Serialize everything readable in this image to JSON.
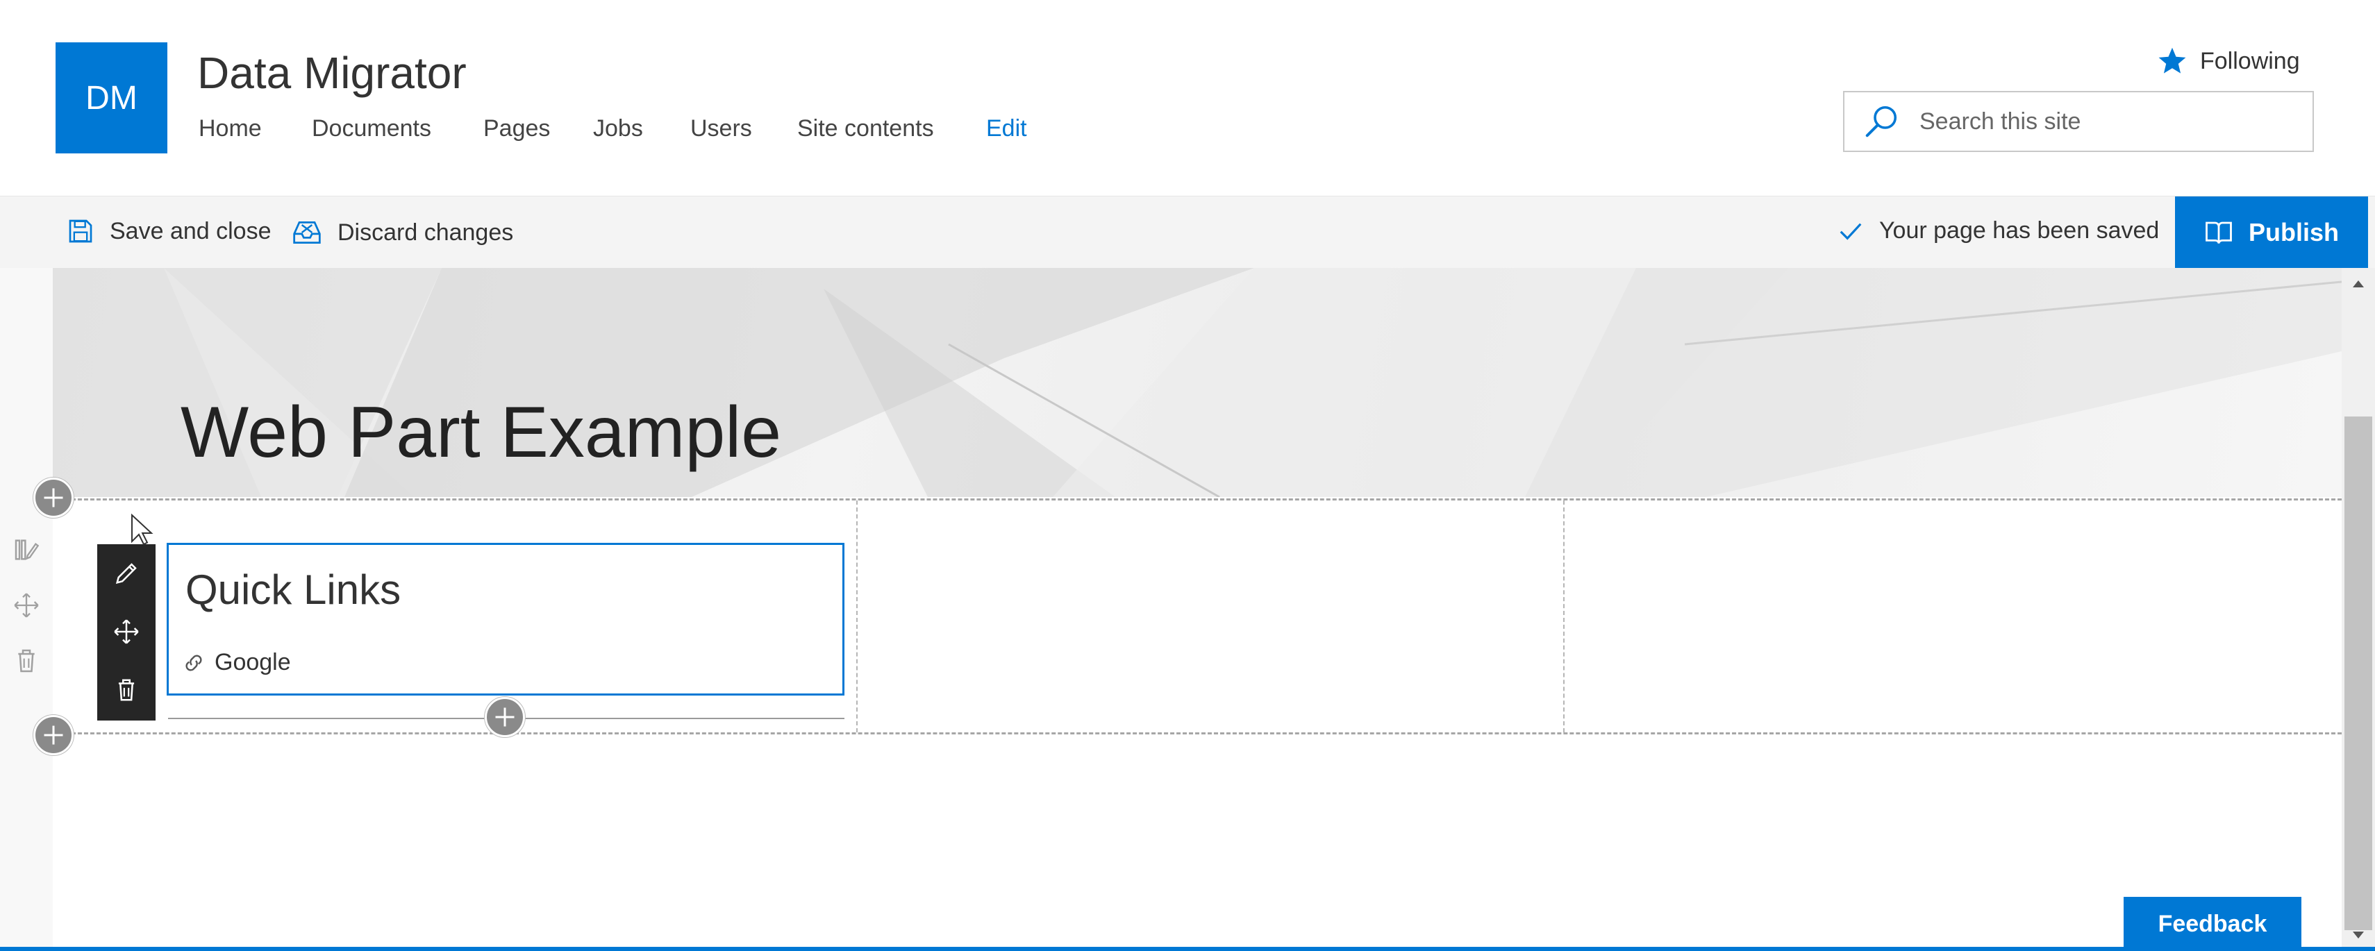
{
  "site": {
    "logo_initials": "DM",
    "title": "Data Migrator",
    "nav": [
      {
        "label": "Home"
      },
      {
        "label": "Documents"
      },
      {
        "label": "Pages"
      },
      {
        "label": "Jobs"
      },
      {
        "label": "Users"
      },
      {
        "label": "Site contents"
      },
      {
        "label": "Edit"
      }
    ],
    "following_label": "Following",
    "search_placeholder": "Search this site"
  },
  "command_bar": {
    "save_close_label": "Save and close",
    "discard_label": "Discard changes",
    "status_text": "Your page has been saved",
    "publish_label": "Publish"
  },
  "page": {
    "title": "Web Part Example",
    "quick_links": {
      "title": "Quick Links",
      "items": [
        {
          "label": "Google"
        }
      ]
    }
  },
  "feedback_label": "Feedback",
  "colors": {
    "accent": "#0078d4",
    "toolbar": "#262626"
  },
  "icons": {
    "star": "star-icon",
    "search": "search-icon",
    "save": "save-icon",
    "discard": "discard-icon",
    "check": "checkmark-icon",
    "publish": "publish-icon",
    "edit": "pencil-icon",
    "move": "move-icon",
    "delete": "trash-icon",
    "link": "link-icon",
    "add": "add-icon"
  }
}
